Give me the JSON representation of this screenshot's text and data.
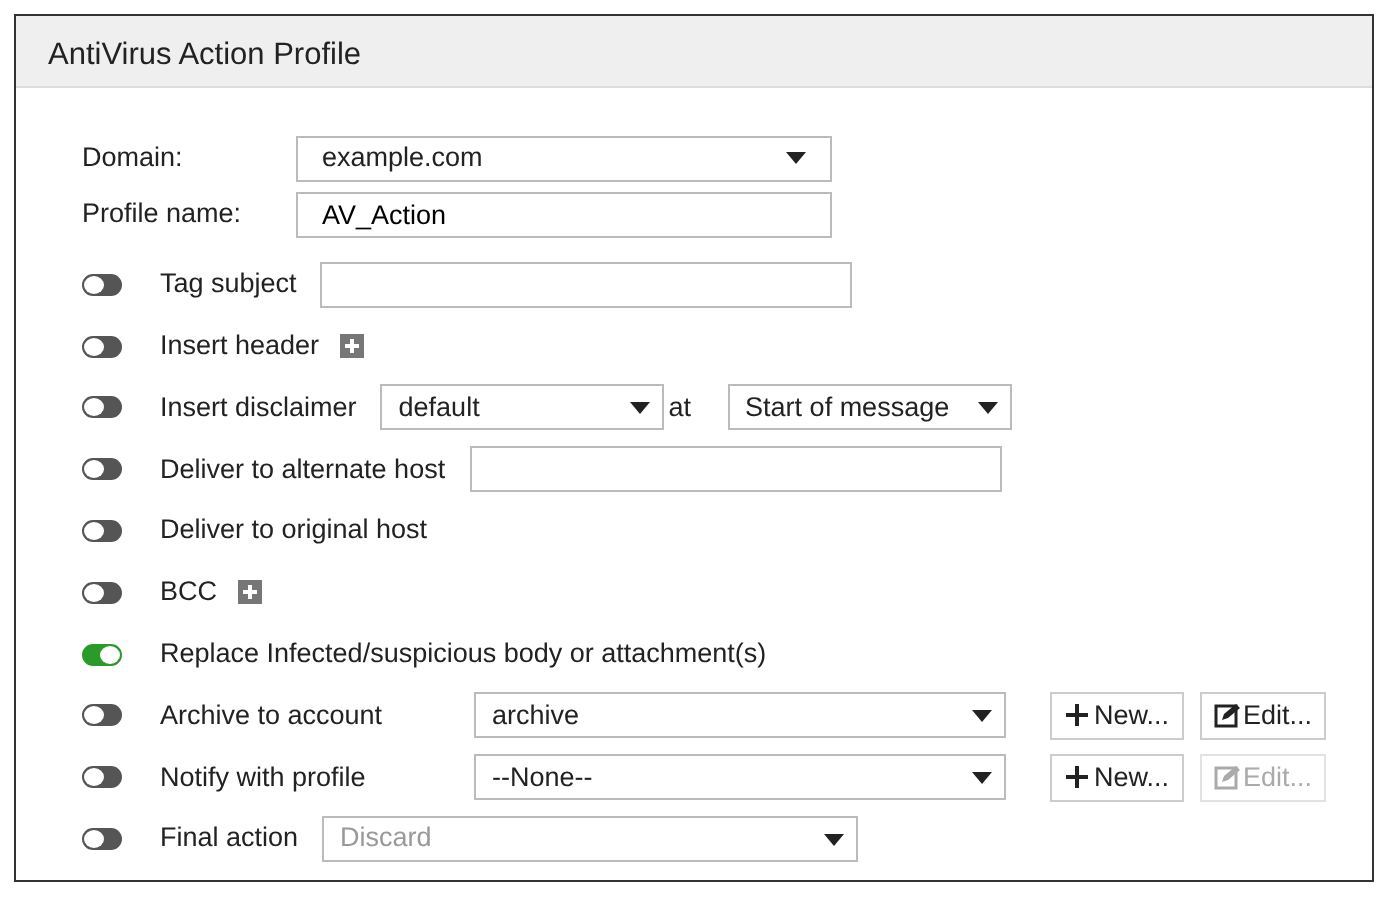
{
  "panel": {
    "title": "AntiVirus Action Profile"
  },
  "fields": [
    {
      "label": "Domain:",
      "kind": "select",
      "value": "example.com"
    },
    {
      "label": "Profile name:",
      "kind": "input",
      "value": "AV_Action"
    }
  ],
  "actions": [
    {
      "label": "Tag subject",
      "on": false,
      "controls": [
        {
          "kind": "input"
        }
      ]
    },
    {
      "label": "Insert header",
      "on": false,
      "controls": [
        {
          "kind": "plus"
        }
      ]
    },
    {
      "label": "Insert disclaimer",
      "on": false,
      "controls": [
        {
          "kind": "select",
          "value": "default",
          "disabled": false
        },
        {
          "kind": "text",
          "text": "at"
        },
        {
          "kind": "select",
          "value": "Start of message",
          "disabled": false
        }
      ]
    },
    {
      "label": "Deliver to alternate host",
      "on": false,
      "controls": [
        {
          "kind": "input"
        }
      ]
    },
    {
      "label": "Deliver to original host",
      "on": false
    },
    {
      "label": "BCC",
      "on": false,
      "controls": [
        {
          "kind": "plus"
        }
      ]
    },
    {
      "label": "Replace Infected/suspicious body or attachment(s)",
      "on": true
    },
    {
      "label": "Archive to account",
      "on": false,
      "controls": [
        {
          "kind": "select",
          "value": "archive",
          "disabled": false
        },
        {
          "kind": "new_button",
          "text": "New...",
          "disabled": false
        },
        {
          "kind": "edit_button",
          "text": "Edit...",
          "disabled": false
        }
      ]
    },
    {
      "label": "Notify with profile",
      "on": false,
      "controls": [
        {
          "kind": "select",
          "value": "--None--",
          "disabled": false
        },
        {
          "kind": "new_button",
          "text": "New...",
          "disabled": false
        },
        {
          "kind": "edit_button",
          "text": "Edit...",
          "disabled": true
        }
      ]
    },
    {
      "label": "Final action",
      "on": false,
      "controls": [
        {
          "kind": "select",
          "value": "Discard",
          "disabled": true
        }
      ]
    }
  ]
}
